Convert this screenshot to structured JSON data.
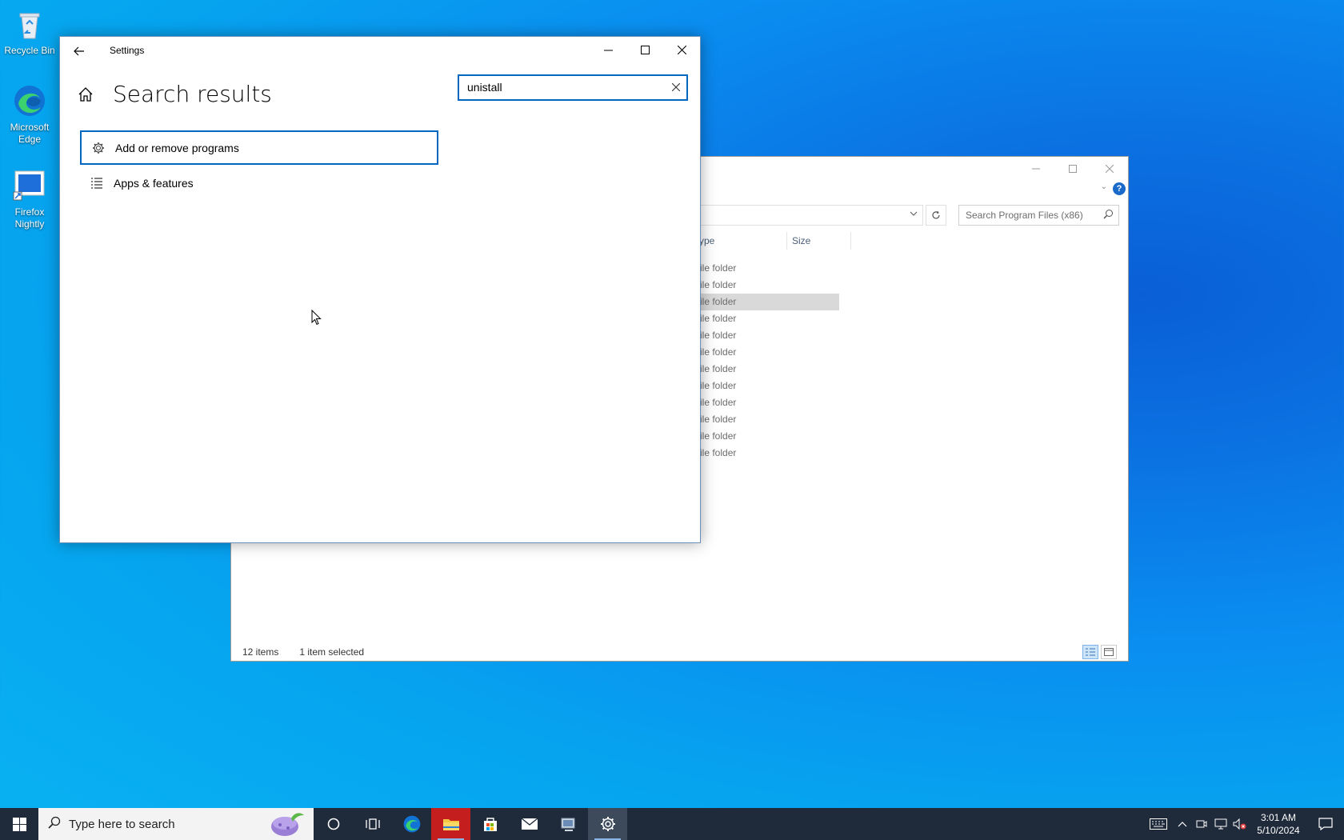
{
  "desktop": {
    "icons": [
      {
        "label": "Recycle Bin"
      },
      {
        "label": "Microsoft Edge"
      },
      {
        "label": "Firefox Nightly"
      }
    ]
  },
  "explorer": {
    "search_placeholder": "Search Program Files (x86)",
    "columns": {
      "type": "ype",
      "size": "Size"
    },
    "rows": [
      "ile folder",
      "ile folder",
      "ile folder",
      "ile folder",
      "ile folder",
      "ile folder",
      "ile folder",
      "ile folder",
      "ile folder",
      "ile folder",
      "ile folder",
      "ile folder"
    ],
    "selected_row_index": 2,
    "status": {
      "items": "12 items",
      "selected": "1 item selected"
    },
    "help_label": "?"
  },
  "settings": {
    "title": "Settings",
    "heading": "Search results",
    "search_value": "unistall",
    "results": [
      {
        "label": "Add or remove programs",
        "icon": "gear-icon"
      },
      {
        "label": "Apps & features",
        "icon": "list-icon"
      }
    ]
  },
  "taskbar": {
    "search_placeholder": "Type here to search",
    "clock_time": "3:01 AM",
    "clock_date": "5/10/2024",
    "apps": [
      "cortana-icon",
      "task-view-icon",
      "edge-icon",
      "file-explorer-icon",
      "store-icon",
      "mail-icon",
      "network-app-icon",
      "settings-icon"
    ]
  },
  "colors": {
    "accent": "#0067c0",
    "taskbar": "#1f2a3a",
    "explorer_selected_row": "#d9d9d9"
  }
}
